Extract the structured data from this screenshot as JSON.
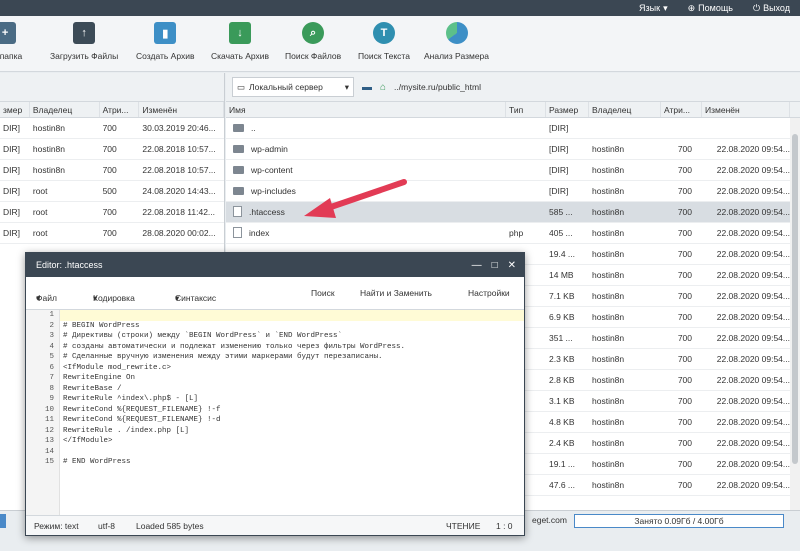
{
  "topbar": {
    "language": "Язык",
    "help": "Помощь",
    "exit": "Выход"
  },
  "toolbar": {
    "new_folder": "ая папка",
    "upload": "Загрузить Файлы",
    "create_archive": "Создать Архив",
    "download_archive": "Скачать Архив",
    "find_files": "Поиск Файлов",
    "find_text": "Поиск Текста",
    "analyze_size": "Анализ Размера"
  },
  "left": {
    "headers": [
      "змер",
      "Владелец",
      "Атри...",
      "Изменён"
    ],
    "rows": [
      [
        "DIR]",
        "hostin8n",
        "700",
        "30.03.2019 20:46..."
      ],
      [
        "DIR]",
        "hostin8n",
        "700",
        "22.08.2018 10:57..."
      ],
      [
        "DIR]",
        "hostin8n",
        "700",
        "22.08.2018 10:57..."
      ],
      [
        "DIR]",
        "root",
        "500",
        "24.08.2020 14:43..."
      ],
      [
        "DIR]",
        "root",
        "700",
        "22.08.2018 11:42..."
      ],
      [
        "DIR]",
        "root",
        "700",
        "28.08.2020 00:02..."
      ]
    ]
  },
  "right": {
    "server": "Локальный сервер",
    "path": "../mysite.ru/public_html",
    "headers": [
      "Имя",
      "Тип",
      "Размер",
      "Владелец",
      "Атри...",
      "Изменён"
    ],
    "rows": [
      {
        "name": "..",
        "type": "",
        "size": "[DIR]",
        "owner": "",
        "attr": "",
        "mod": ""
      },
      {
        "name": "wp-admin",
        "type": "",
        "size": "[DIR]",
        "owner": "hostin8n",
        "attr": "700",
        "mod": "22.08.2020 09:54..."
      },
      {
        "name": "wp-content",
        "type": "",
        "size": "[DIR]",
        "owner": "hostin8n",
        "attr": "700",
        "mod": "22.08.2020 09:54..."
      },
      {
        "name": "wp-includes",
        "type": "",
        "size": "[DIR]",
        "owner": "hostin8n",
        "attr": "700",
        "mod": "22.08.2020 09:54..."
      },
      {
        "name": ".htaccess",
        "type": "",
        "size": "585 ...",
        "owner": "hostin8n",
        "attr": "700",
        "mod": "22.08.2020 09:54..."
      },
      {
        "name": "index",
        "type": "php",
        "size": "405 ...",
        "owner": "hostin8n",
        "attr": "700",
        "mod": "22.08.2020 09:54..."
      },
      {
        "name": "",
        "type": "",
        "size": "19.4 ...",
        "owner": "hostin8n",
        "attr": "700",
        "mod": "22.08.2020 09:54..."
      },
      {
        "name": "",
        "type": "",
        "size": "14 MB",
        "owner": "hostin8n",
        "attr": "700",
        "mod": "22.08.2020 09:54..."
      },
      {
        "name": "",
        "type": "",
        "size": "7.1 KB",
        "owner": "hostin8n",
        "attr": "700",
        "mod": "22.08.2020 09:54..."
      },
      {
        "name": "",
        "type": "",
        "size": "6.9 KB",
        "owner": "hostin8n",
        "attr": "700",
        "mod": "22.08.2020 09:54..."
      },
      {
        "name": "",
        "type": "",
        "size": "351 ...",
        "owner": "hostin8n",
        "attr": "700",
        "mod": "22.08.2020 09:54..."
      },
      {
        "name": "",
        "type": "",
        "size": "2.3 KB",
        "owner": "hostin8n",
        "attr": "700",
        "mod": "22.08.2020 09:54..."
      },
      {
        "name": "",
        "type": "",
        "size": "2.8 KB",
        "owner": "hostin8n",
        "attr": "700",
        "mod": "22.08.2020 09:54..."
      },
      {
        "name": "",
        "type": "",
        "size": "3.1 KB",
        "owner": "hostin8n",
        "attr": "700",
        "mod": "22.08.2020 09:54..."
      },
      {
        "name": "",
        "type": "",
        "size": "4.8 KB",
        "owner": "hostin8n",
        "attr": "700",
        "mod": "22.08.2020 09:54..."
      },
      {
        "name": "",
        "type": "",
        "size": "2.4 KB",
        "owner": "hostin8n",
        "attr": "700",
        "mod": "22.08.2020 09:54..."
      },
      {
        "name": "",
        "type": "",
        "size": "19.1 ...",
        "owner": "hostin8n",
        "attr": "700",
        "mod": "22.08.2020 09:54..."
      },
      {
        "name": "",
        "type": "",
        "size": "47.6 ...",
        "owner": "hostin8n",
        "attr": "700",
        "mod": "22.08.2020 09:54..."
      }
    ]
  },
  "bottombar": {
    "host_fragment": "eget.com",
    "occupied": "Занято 0.09Гб / 4.00Гб"
  },
  "editor": {
    "title": "Editor: .htaccess",
    "menu": {
      "file": "Файл",
      "encoding": "Кодировка",
      "syntax": "Синтаксис",
      "search": "Поиск",
      "find_replace": "Найти и Заменить",
      "settings": "Настройки"
    },
    "lines": [
      "",
      "# BEGIN WordPress",
      "# Директивы (строки) между `BEGIN WordPress` и `END WordPress`",
      "# созданы автоматически и подлежат изменению только через фильтры WordPress.",
      "# Сделанные вручную изменения между этими маркерами будут перезаписаны.",
      "<IfModule mod_rewrite.c>",
      "RewriteEngine On",
      "RewriteBase /",
      "RewriteRule ^index\\.php$ - [L]",
      "RewriteCond %{REQUEST_FILENAME} !-f",
      "RewriteCond %{REQUEST_FILENAME} !-d",
      "RewriteRule . /index.php [L]",
      "</IfModule>",
      "",
      "# END WordPress"
    ],
    "status": {
      "mode": "Режим: text",
      "encoding": "utf-8",
      "loaded": "Loaded 585 bytes",
      "readonly": "ЧТЕНИЕ",
      "position": "1 : 0"
    }
  }
}
